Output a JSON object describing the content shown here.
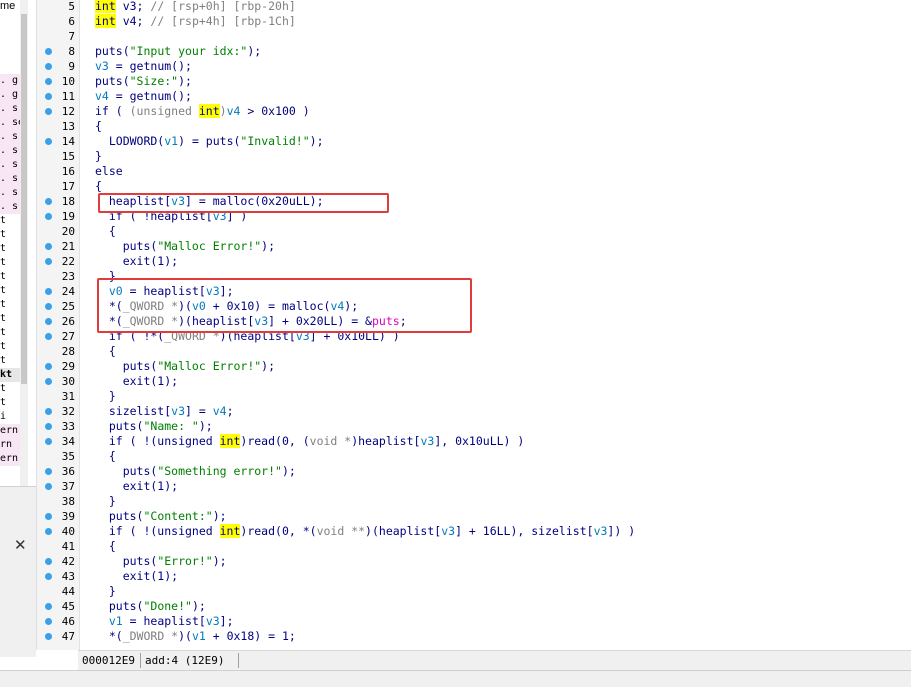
{
  "left_panel": {
    "title": "me",
    "rows": [
      {
        "text": ". g",
        "style": "pink"
      },
      {
        "text": ". g",
        "style": "pink"
      },
      {
        "text": ". s",
        "style": "pink"
      },
      {
        "text": ". se",
        "style": "pink"
      },
      {
        "text": ". s",
        "style": "pink"
      },
      {
        "text": ". s",
        "style": "pink"
      },
      {
        "text": ". s",
        "style": "pink"
      },
      {
        "text": ". s",
        "style": "pink"
      },
      {
        "text": ". s",
        "style": "pink"
      },
      {
        "text": ". s",
        "style": "pink"
      },
      {
        "text": "t",
        "style": ""
      },
      {
        "text": "t",
        "style": ""
      },
      {
        "text": "t",
        "style": ""
      },
      {
        "text": "t",
        "style": ""
      },
      {
        "text": "t",
        "style": ""
      },
      {
        "text": "t",
        "style": ""
      },
      {
        "text": "t",
        "style": ""
      },
      {
        "text": "t",
        "style": ""
      },
      {
        "text": "t",
        "style": ""
      },
      {
        "text": "t",
        "style": ""
      },
      {
        "text": "t",
        "style": ""
      },
      {
        "text": "kt",
        "style": "selected"
      },
      {
        "text": "t",
        "style": ""
      },
      {
        "text": "t",
        "style": ""
      },
      {
        "text": "i",
        "style": ""
      },
      {
        "text": "ern",
        "style": "pink"
      },
      {
        "text": "rn",
        "style": "pink"
      },
      {
        "text": "ern",
        "style": "pink"
      }
    ],
    "close_icon": "close-icon",
    "close_glyph": "✕"
  },
  "code_lines": [
    {
      "num": "5",
      "dot": false,
      "html": "<span class=\"kw\">int</span> v3; <span class=\"c\">// [rsp+0h] [rbp-20h]</span>"
    },
    {
      "num": "6",
      "dot": false,
      "html": "<span class=\"kw\">int</span> v4; <span class=\"c\">// [rsp+4h] [rbp-1Ch]</span>"
    },
    {
      "num": "7",
      "dot": false,
      "html": ""
    },
    {
      "num": "8",
      "dot": true,
      "html": "puts(<span class=\"s\">\"Input your idx:\"</span>);"
    },
    {
      "num": "9",
      "dot": true,
      "html": "<span class=\"v\">v3</span> = getnum();"
    },
    {
      "num": "10",
      "dot": true,
      "html": "puts(<span class=\"s\">\"Size:\"</span>);"
    },
    {
      "num": "11",
      "dot": true,
      "html": "<span class=\"v\">v4</span> = getnum();"
    },
    {
      "num": "12",
      "dot": true,
      "html": "if ( <span class=\"c\">(unsigned </span><span class=\"kw\">int</span><span class=\"c\">)</span><span class=\"v\">v4</span> &gt; 0x100 )"
    },
    {
      "num": "13",
      "dot": false,
      "html": "{"
    },
    {
      "num": "14",
      "dot": true,
      "html": "  LODWORD(<span class=\"v\">v1</span>) = puts(<span class=\"s\">\"Invalid!\"</span>);"
    },
    {
      "num": "15",
      "dot": false,
      "html": "}"
    },
    {
      "num": "16",
      "dot": false,
      "html": "else"
    },
    {
      "num": "17",
      "dot": false,
      "html": "{"
    },
    {
      "num": "18",
      "dot": true,
      "html": "  heaplist[<span class=\"v\">v3</span>] = malloc(0x20uLL);"
    },
    {
      "num": "19",
      "dot": true,
      "html": "  if ( !heaplist[<span class=\"v\">v3</span>] )"
    },
    {
      "num": "20",
      "dot": false,
      "html": "  {"
    },
    {
      "num": "21",
      "dot": true,
      "html": "    puts(<span class=\"s\">\"Malloc Error!\"</span>);"
    },
    {
      "num": "22",
      "dot": true,
      "html": "    exit(1);"
    },
    {
      "num": "23",
      "dot": false,
      "html": "  }"
    },
    {
      "num": "24",
      "dot": true,
      "html": "  <span class=\"v\">v0</span> = heaplist[<span class=\"v\">v3</span>];"
    },
    {
      "num": "25",
      "dot": true,
      "html": "  *(<span class=\"c\">_QWORD *</span>)(<span class=\"v\">v0</span> + 0x10) = malloc(<span class=\"v\">v4</span>);"
    },
    {
      "num": "26",
      "dot": true,
      "html": "  *(<span class=\"c\">_QWORD *</span>)(heaplist[<span class=\"v\">v3</span>] + 0x20LL) = &amp;<span class=\"m\">puts</span>;"
    },
    {
      "num": "27",
      "dot": true,
      "html": "  if ( !*(<span class=\"c\">_QWORD *</span>)(heaplist[<span class=\"v\">v3</span>] + 0x10LL) )"
    },
    {
      "num": "28",
      "dot": false,
      "html": "  {"
    },
    {
      "num": "29",
      "dot": true,
      "html": "    puts(<span class=\"s\">\"Malloc Error!\"</span>);"
    },
    {
      "num": "30",
      "dot": true,
      "html": "    exit(1);"
    },
    {
      "num": "31",
      "dot": false,
      "html": "  }"
    },
    {
      "num": "32",
      "dot": true,
      "html": "  sizelist[<span class=\"v\">v3</span>] = <span class=\"v\">v4</span>;"
    },
    {
      "num": "33",
      "dot": true,
      "html": "  puts(<span class=\"s\">\"Name: \"</span>);"
    },
    {
      "num": "34",
      "dot": true,
      "html": "  if ( !(unsigned <span class=\"kw\">int</span>)read(0, (<span class=\"c\">void *</span>)heaplist[<span class=\"v\">v3</span>], 0x10uLL) )"
    },
    {
      "num": "35",
      "dot": false,
      "html": "  {"
    },
    {
      "num": "36",
      "dot": true,
      "html": "    puts(<span class=\"s\">\"Something error!\"</span>);"
    },
    {
      "num": "37",
      "dot": true,
      "html": "    exit(1);"
    },
    {
      "num": "38",
      "dot": false,
      "html": "  }"
    },
    {
      "num": "39",
      "dot": true,
      "html": "  puts(<span class=\"s\">\"Content:\"</span>);"
    },
    {
      "num": "40",
      "dot": true,
      "html": "  if ( !(unsigned <span class=\"kw\">int</span>)read(0, *(<span class=\"c\">void **</span>)(heaplist[<span class=\"v\">v3</span>] + 16LL), sizelist[<span class=\"v\">v3</span>]) )"
    },
    {
      "num": "41",
      "dot": false,
      "html": "  {"
    },
    {
      "num": "42",
      "dot": true,
      "html": "    puts(<span class=\"s\">\"Error!\"</span>);"
    },
    {
      "num": "43",
      "dot": true,
      "html": "    exit(1);"
    },
    {
      "num": "44",
      "dot": false,
      "html": "  }"
    },
    {
      "num": "45",
      "dot": true,
      "html": "  puts(<span class=\"s\">\"Done!\"</span>);"
    },
    {
      "num": "46",
      "dot": true,
      "html": "  <span class=\"v\">v1</span> = heaplist[<span class=\"v\">v3</span>];"
    },
    {
      "num": "47",
      "dot": true,
      "html": "  *(<span class=\"c\">_DWORD *</span>)(<span class=\"v\">v1</span> + 0x18) = 1;"
    }
  ],
  "status_bar": {
    "address": "000012E9",
    "location": "add:4 (12E9)"
  },
  "colors": {
    "highlight_box": "#e03c3c",
    "keyword_bg": "#ffff00",
    "string": "#008000",
    "variable": "#007bbb",
    "breakpoint_dot": "#3aa0e8"
  }
}
